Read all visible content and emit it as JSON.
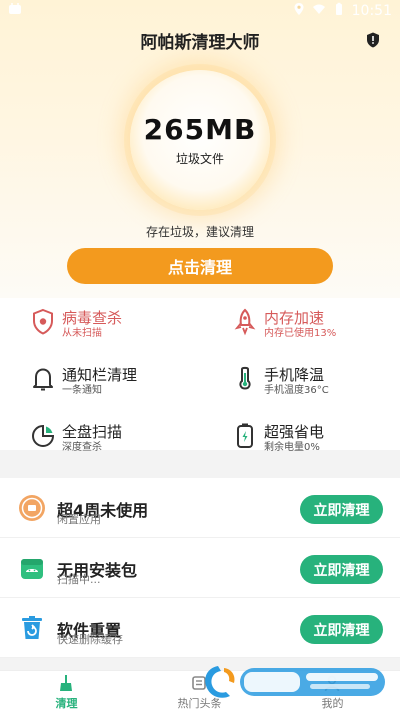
{
  "status_bar": {
    "time": "10:51"
  },
  "header": {
    "title": "阿帕斯清理大师",
    "shield_icon": "shield-alert-icon"
  },
  "scan": {
    "size": "265MB",
    "size_label": "垃圾文件",
    "hint": "存在垃圾，建议清理",
    "clean_button": "点击清理"
  },
  "tools": [
    {
      "title": "病毒查杀",
      "subtitle": "从未扫描",
      "icon": "virus-shield-icon"
    },
    {
      "title": "内存加速",
      "subtitle": "内存已使用13%",
      "icon": "rocket-icon"
    },
    {
      "title": "通知栏清理",
      "subtitle": "一条通知",
      "icon": "bell-icon"
    },
    {
      "title": "手机降温",
      "subtitle": "手机温度36°C",
      "icon": "thermometer-icon"
    },
    {
      "title": "全盘扫描",
      "subtitle": "深度查杀",
      "icon": "disk-scan-icon"
    },
    {
      "title": "超强省电",
      "subtitle": "剩余电量0%",
      "icon": "battery-icon"
    }
  ],
  "list": [
    {
      "title": "超4周未使用",
      "subtitle": "闲置应用",
      "button": "立即清理",
      "icon": "idle-apps-icon"
    },
    {
      "title": "无用安装包",
      "subtitle": "扫描中...",
      "button": "立即清理",
      "icon": "android-package-icon"
    },
    {
      "title": "软件重置",
      "subtitle": "快速删除缓存",
      "button": "立即清理",
      "icon": "trash-reset-icon"
    }
  ],
  "nav": [
    {
      "label": "清理",
      "icon": "broom-icon"
    },
    {
      "label": "热门头条",
      "icon": "news-icon"
    },
    {
      "label": "我的",
      "icon": "user-icon"
    }
  ],
  "colors": {
    "accent_orange": "#f39a1e",
    "accent_green": "#27b27c",
    "alert_red": "#d65a5a"
  }
}
